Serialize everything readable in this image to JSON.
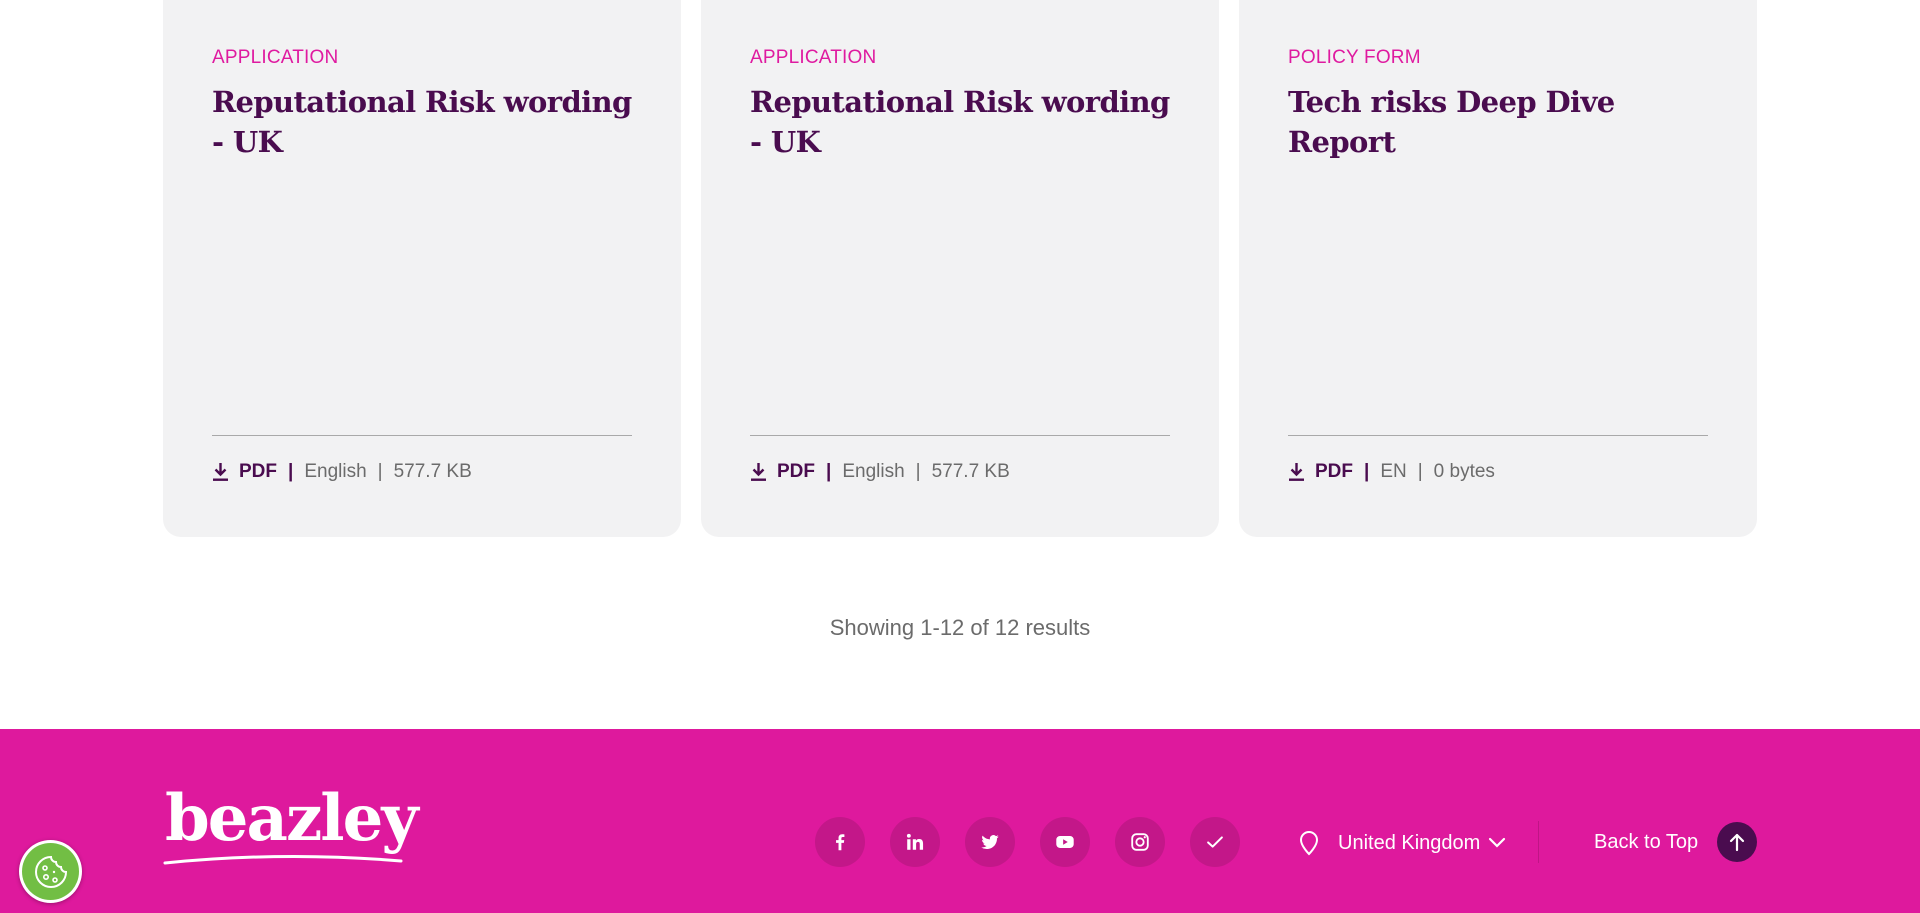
{
  "cards": [
    {
      "category": "APPLICATION",
      "title": "Reputational Risk wording - UK",
      "format": "PDF",
      "language": "English",
      "size": "577.7 KB"
    },
    {
      "category": "APPLICATION",
      "title": "Reputational Risk wording - UK",
      "format": "PDF",
      "language": "English",
      "size": "577.7 KB"
    },
    {
      "category": "POLICY FORM",
      "title": "Tech risks Deep Dive Report",
      "format": "PDF",
      "language": "EN",
      "size": "0 bytes"
    }
  ],
  "separator": "|",
  "results_text": "Showing 1-12 of 12 results",
  "footer": {
    "logo_text": "beazley",
    "social_icons": [
      "facebook-icon",
      "linkedin-icon",
      "twitter-icon",
      "youtube-icon",
      "instagram-icon",
      "checkmark-icon"
    ],
    "region_label": "United Kingdom",
    "back_to_top_label": "Back to Top"
  },
  "colors": {
    "accent_pink": "#de199d",
    "brand_purple": "#4a0c4f",
    "card_bg": "#f2f2f3",
    "cookie_green": "#72be44"
  }
}
